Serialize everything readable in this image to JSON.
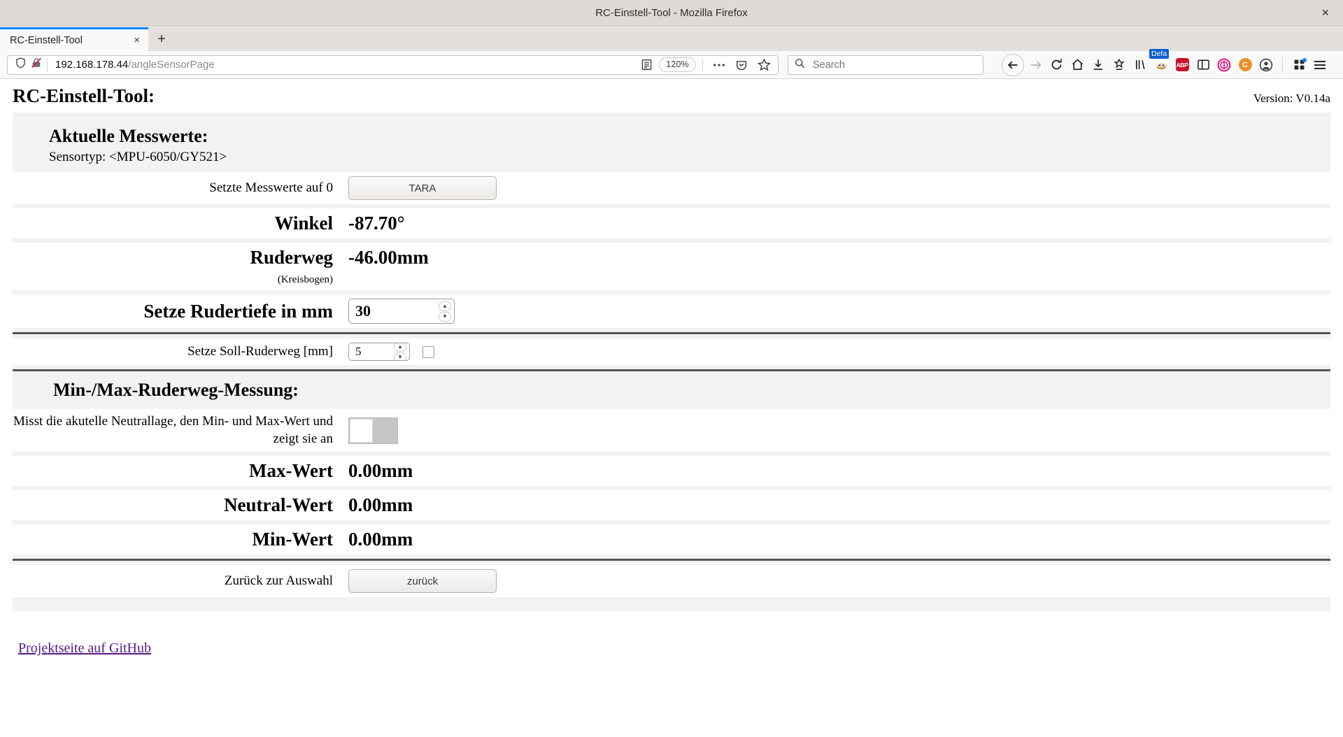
{
  "browser": {
    "window_title": "RC-Einstell-Tool - Mozilla Firefox",
    "close_label": "×",
    "tab_title": "RC-Einstell-Tool",
    "tab_close_label": "×",
    "new_tab_label": "+",
    "url_host": "192.168.178.44",
    "url_path": "/angleSensorPage",
    "zoom_level": "120%",
    "search_placeholder": "Search",
    "search_value": "",
    "extension_badge_text": "Defa",
    "abp_label": "ABP",
    "container_label": "C",
    "icons": [
      "shield-icon",
      "insecure-connection-icon",
      "reader-mode-icon",
      "page-actions-icon",
      "pocket-icon",
      "bookmark-star-icon",
      "back-icon",
      "forward-icon",
      "reload-icon",
      "home-icon",
      "downloads-icon",
      "save-to-pocket-icon",
      "library-icon",
      "default-extension-icon",
      "adblock-plus-icon",
      "sidebar-icon",
      "magenta-extension-icon",
      "container-tabs-icon",
      "account-icon",
      "extensions-icon",
      "app-menu-icon"
    ]
  },
  "page": {
    "app_title": "RC-Einstell-Tool:",
    "version": "Version: V0.14a",
    "measurements": {
      "section_title": "Aktuelle Messwerte:",
      "sensor_type": "Sensortyp: <MPU-6050/GY521>",
      "tara_label": "Setzte Messwerte auf 0",
      "tara_button": "TARA",
      "angle_label": "Winkel",
      "angle_value": "-87.70°",
      "rudder_label": "Ruderweg",
      "rudder_value": "-46.00mm",
      "rudder_note": "(Kreisbogen)",
      "depth_label": "Setze Rudertiefe in mm",
      "depth_value": "30"
    },
    "target": {
      "label": "Setze Soll-Ruderweg [mm]",
      "value": "5",
      "checkbox_checked": false
    },
    "minmax": {
      "section_title": "Min-/Max-Ruderweg-Messung:",
      "description": "Misst die akutelle Neutrallage, den Min- und Max-Wert und zeigt sie an",
      "toggle_on": false,
      "max_label": "Max-Wert",
      "max_value": "0.00mm",
      "neutral_label": "Neutral-Wert",
      "neutral_value": "0.00mm",
      "min_label": "Min-Wert",
      "min_value": "0.00mm"
    },
    "back": {
      "label": "Zurück zur Auswahl",
      "button": "zurück"
    },
    "github_link": "Projektseite auf GitHub"
  }
}
